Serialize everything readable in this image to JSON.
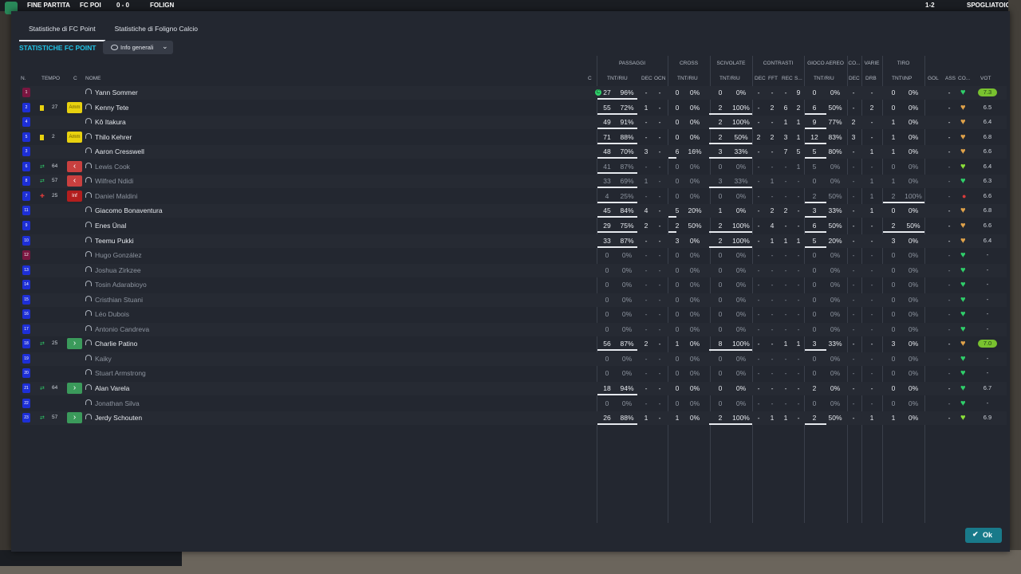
{
  "topbar": {
    "match_label": "FINE PARTITA",
    "home": "FC POI",
    "score": "0 - 0",
    "away": "FOLIGN",
    "page": "1-2",
    "button": "SPOGLIATOIO"
  },
  "tabs": [
    "Statistiche di FC Point",
    "Statistiche di Foligno Calcio"
  ],
  "title": "STATISTICHE FC POINT",
  "dropdown": "Info generali",
  "ok": "Ok",
  "groups": {
    "passaggi": "PASSAGGI",
    "cross": "CROSS",
    "scivolate": "SCIVOLATE",
    "contrasti": "CONTRASTI",
    "gioco_aereo": "GIOCO AEREO",
    "co": "CO...",
    "varie": "VARIE",
    "tiro": "TIRO"
  },
  "headers": {
    "n": "N.",
    "tempo": "TEMPO",
    "c": "C",
    "nome": "NOME",
    "cap": "C",
    "pass_tnt": "TNT/RIU",
    "pass_dec": "DEC",
    "pass_ocn": "OCN",
    "cross_tnt": "TNT/RIU",
    "sciv_tnt": "TNT/RIU",
    "con_dec": "DEC",
    "con_fft": "FFT",
    "con_rec": "REC",
    "con_s": "S...",
    "aer_tnt": "TNT/RIU",
    "co_dec": "DEC",
    "drb": "DRB",
    "tiro": "TNT\\INP",
    "gol": "GOL",
    "ass": "ASS",
    "co2": "CO...",
    "vot": "VOT"
  },
  "players": [
    {
      "n": "1",
      "gk": true,
      "ev": "",
      "min": "",
      "pos": "",
      "name": "Yann Sommer",
      "dim": false,
      "cap": "C",
      "p": [
        "27",
        "96%"
      ],
      "pdec": "-",
      "pocn": "-",
      "cr": [
        "0",
        "0%"
      ],
      "sc": [
        "0",
        "0%"
      ],
      "con": [
        "-",
        "-",
        "-",
        "9"
      ],
      "aer": [
        "0",
        "0%"
      ],
      "codec": "-",
      "drb": "-",
      "tiro": [
        "0",
        "0%"
      ],
      "gol": "",
      "ass": "-",
      "heart": "g",
      "vot": "7.3",
      "hi": true,
      "ulp": true,
      "ulcr": false,
      "ulsc": false,
      "ulaer": false,
      "ultiro": false
    },
    {
      "n": "2",
      "ev": "yc",
      "min": "27",
      "pos": "Amm",
      "name": "Kenny Tete",
      "p": [
        "55",
        "72%"
      ],
      "pdec": "1",
      "pocn": "-",
      "cr": [
        "0",
        "0%"
      ],
      "sc": [
        "2",
        "100%"
      ],
      "con": [
        "-",
        "2",
        "6",
        "2"
      ],
      "aer": [
        "6",
        "50%"
      ],
      "codec": "-",
      "drb": "2",
      "tiro": [
        "0",
        "0%"
      ],
      "ass": "-",
      "heart": "or",
      "vot": "6.5",
      "ulp": true,
      "ulsc": true,
      "ulaer": true
    },
    {
      "n": "4",
      "ev": "",
      "min": "",
      "pos": "",
      "name": "Kô Itakura",
      "p": [
        "49",
        "91%"
      ],
      "pdec": "-",
      "pocn": "-",
      "cr": [
        "0",
        "0%"
      ],
      "sc": [
        "2",
        "100%"
      ],
      "con": [
        "-",
        "-",
        "1",
        "1"
      ],
      "aer": [
        "9",
        "77%"
      ],
      "codec": "2",
      "drb": "-",
      "tiro": [
        "1",
        "0%"
      ],
      "ass": "-",
      "heart": "or",
      "vot": "6.4",
      "ulp": true,
      "ulsc": true,
      "ulaer": true
    },
    {
      "n": "5",
      "ev": "yc",
      "min": "2",
      "pos": "Amm",
      "name": "Thilo Kehrer",
      "p": [
        "71",
        "88%"
      ],
      "pdec": "-",
      "pocn": "-",
      "cr": [
        "0",
        "0%"
      ],
      "sc": [
        "2",
        "50%"
      ],
      "con": [
        "2",
        "2",
        "3",
        "1"
      ],
      "aer": [
        "12",
        "83%"
      ],
      "codec": "3",
      "drb": "-",
      "tiro": [
        "1",
        "0%"
      ],
      "ass": "-",
      "heart": "or",
      "vot": "6.8",
      "ulp": true,
      "ulsc": true,
      "ulaer": true
    },
    {
      "n": "3",
      "ev": "",
      "min": "",
      "pos": "",
      "name": "Aaron Cresswell",
      "p": [
        "48",
        "70%"
      ],
      "pdec": "3",
      "pocn": "-",
      "cr": [
        "6",
        "16%"
      ],
      "sc": [
        "3",
        "33%"
      ],
      "con": [
        "-",
        "-",
        "7",
        "5"
      ],
      "aer": [
        "5",
        "80%"
      ],
      "codec": "-",
      "drb": "1",
      "tiro": [
        "1",
        "0%"
      ],
      "ass": "-",
      "heart": "or",
      "vot": "6.6",
      "ulp": true,
      "ulcr": true,
      "ulsc": true,
      "ulaer": true
    },
    {
      "n": "6",
      "ev": "sub",
      "min": "64",
      "pos": "out",
      "name": "Lewis Cook",
      "dim": true,
      "p": [
        "41",
        "87%"
      ],
      "pdec": "-",
      "pocn": "-",
      "cr": [
        "0",
        "0%"
      ],
      "sc": [
        "0",
        "0%"
      ],
      "con": [
        "-",
        "-",
        "-",
        "1"
      ],
      "aer": [
        "5",
        "0%"
      ],
      "codec": "-",
      "drb": "-",
      "tiro": [
        "0",
        "0%"
      ],
      "ass": "-",
      "heart": "cy",
      "vot": "6.4",
      "ulp": true
    },
    {
      "n": "8",
      "ev": "sub",
      "min": "57",
      "pos": "out",
      "name": "Wilfred Ndidi",
      "dim": true,
      "p": [
        "33",
        "69%"
      ],
      "pdec": "1",
      "pocn": "-",
      "cr": [
        "0",
        "0%"
      ],
      "sc": [
        "3",
        "33%"
      ],
      "con": [
        "-",
        "1",
        "-",
        "-"
      ],
      "aer": [
        "0",
        "0%"
      ],
      "codec": "-",
      "drb": "1",
      "tiro": [
        "1",
        "0%"
      ],
      "ass": "-",
      "heart": "g",
      "vot": "6.3",
      "ulp": true,
      "ulsc": true
    },
    {
      "n": "7",
      "ev": "rc",
      "min": "25",
      "pos": "Inf",
      "name": "Daniel Maldini",
      "dim": true,
      "p": [
        "4",
        "25%"
      ],
      "pdec": "-",
      "pocn": "-",
      "cr": [
        "0",
        "0%"
      ],
      "sc": [
        "0",
        "0%"
      ],
      "con": [
        "-",
        "-",
        "-",
        "-"
      ],
      "aer": [
        "2",
        "50%"
      ],
      "codec": "-",
      "drb": "1",
      "tiro": [
        "2",
        "100%"
      ],
      "ass": "-",
      "heart": "rd",
      "vot": "6.6",
      "ulp": true,
      "ulaer": true,
      "ultiro": true
    },
    {
      "n": "11",
      "ev": "",
      "min": "",
      "pos": "",
      "name": "Giacomo Bonaventura",
      "p": [
        "45",
        "84%"
      ],
      "pdec": "4",
      "pocn": "-",
      "cr": [
        "5",
        "20%"
      ],
      "sc": [
        "1",
        "0%"
      ],
      "con": [
        "-",
        "2",
        "2",
        "-"
      ],
      "aer": [
        "3",
        "33%"
      ],
      "codec": "-",
      "drb": "1",
      "tiro": [
        "0",
        "0%"
      ],
      "ass": "-",
      "heart": "or",
      "vot": "6.8",
      "ulp": true,
      "ulcr": true,
      "ulaer": true
    },
    {
      "n": "9",
      "ev": "",
      "min": "",
      "pos": "",
      "name": "Enes Ünal",
      "p": [
        "29",
        "75%"
      ],
      "pdec": "2",
      "pocn": "-",
      "cr": [
        "2",
        "50%"
      ],
      "sc": [
        "2",
        "100%"
      ],
      "con": [
        "-",
        "4",
        "-",
        "-"
      ],
      "aer": [
        "6",
        "50%"
      ],
      "codec": "-",
      "drb": "-",
      "tiro": [
        "2",
        "50%"
      ],
      "ass": "-",
      "heart": "or",
      "vot": "6.6",
      "ulp": true,
      "ulcr": true,
      "ulsc": true,
      "ulaer": true,
      "ultiro": true
    },
    {
      "n": "10",
      "ev": "",
      "min": "",
      "pos": "",
      "name": "Teemu Pukki",
      "p": [
        "33",
        "87%"
      ],
      "pdec": "-",
      "pocn": "-",
      "cr": [
        "3",
        "0%"
      ],
      "sc": [
        "2",
        "100%"
      ],
      "con": [
        "-",
        "1",
        "1",
        "1"
      ],
      "aer": [
        "5",
        "20%"
      ],
      "codec": "-",
      "drb": "-",
      "tiro": [
        "3",
        "0%"
      ],
      "ass": "-",
      "heart": "or",
      "vot": "6.4",
      "ulp": true,
      "ulsc": true,
      "ulaer": true
    },
    {
      "n": "12",
      "gk": true,
      "ev": "",
      "min": "",
      "pos": "",
      "name": "Hugo González",
      "dim": true,
      "p": [
        "0",
        "0%"
      ],
      "pdec": "-",
      "pocn": "-",
      "cr": [
        "0",
        "0%"
      ],
      "sc": [
        "0",
        "0%"
      ],
      "con": [
        "-",
        "-",
        "-",
        "-"
      ],
      "aer": [
        "0",
        "0%"
      ],
      "codec": "-",
      "drb": "-",
      "tiro": [
        "0",
        "0%"
      ],
      "ass": "-",
      "heart": "g",
      "vot": "-"
    },
    {
      "n": "13",
      "ev": "",
      "min": "",
      "pos": "",
      "name": "Joshua Zirkzee",
      "dim": true,
      "p": [
        "0",
        "0%"
      ],
      "pdec": "-",
      "pocn": "-",
      "cr": [
        "0",
        "0%"
      ],
      "sc": [
        "0",
        "0%"
      ],
      "con": [
        "-",
        "-",
        "-",
        "-"
      ],
      "aer": [
        "0",
        "0%"
      ],
      "codec": "-",
      "drb": "-",
      "tiro": [
        "0",
        "0%"
      ],
      "ass": "-",
      "heart": "g",
      "vot": "-"
    },
    {
      "n": "14",
      "ev": "",
      "min": "",
      "pos": "",
      "name": "Tosin Adarabioyo",
      "dim": true,
      "p": [
        "0",
        "0%"
      ],
      "pdec": "-",
      "pocn": "-",
      "cr": [
        "0",
        "0%"
      ],
      "sc": [
        "0",
        "0%"
      ],
      "con": [
        "-",
        "-",
        "-",
        "-"
      ],
      "aer": [
        "0",
        "0%"
      ],
      "codec": "-",
      "drb": "-",
      "tiro": [
        "0",
        "0%"
      ],
      "ass": "-",
      "heart": "g",
      "vot": "-"
    },
    {
      "n": "15",
      "ev": "",
      "min": "",
      "pos": "",
      "name": "Cristhian Stuani",
      "dim": true,
      "p": [
        "0",
        "0%"
      ],
      "pdec": "-",
      "pocn": "-",
      "cr": [
        "0",
        "0%"
      ],
      "sc": [
        "0",
        "0%"
      ],
      "con": [
        "-",
        "-",
        "-",
        "-"
      ],
      "aer": [
        "0",
        "0%"
      ],
      "codec": "-",
      "drb": "-",
      "tiro": [
        "0",
        "0%"
      ],
      "ass": "-",
      "heart": "g",
      "vot": "-"
    },
    {
      "n": "16",
      "ev": "",
      "min": "",
      "pos": "",
      "name": "Léo Dubois",
      "dim": true,
      "p": [
        "0",
        "0%"
      ],
      "pdec": "-",
      "pocn": "-",
      "cr": [
        "0",
        "0%"
      ],
      "sc": [
        "0",
        "0%"
      ],
      "con": [
        "-",
        "-",
        "-",
        "-"
      ],
      "aer": [
        "0",
        "0%"
      ],
      "codec": "-",
      "drb": "-",
      "tiro": [
        "0",
        "0%"
      ],
      "ass": "-",
      "heart": "g",
      "vot": "-"
    },
    {
      "n": "17",
      "ev": "",
      "min": "",
      "pos": "",
      "name": "Antonio Candreva",
      "dim": true,
      "p": [
        "0",
        "0%"
      ],
      "pdec": "-",
      "pocn": "-",
      "cr": [
        "0",
        "0%"
      ],
      "sc": [
        "0",
        "0%"
      ],
      "con": [
        "-",
        "-",
        "-",
        "-"
      ],
      "aer": [
        "0",
        "0%"
      ],
      "codec": "-",
      "drb": "-",
      "tiro": [
        "0",
        "0%"
      ],
      "ass": "-",
      "heart": "g",
      "vot": "-"
    },
    {
      "n": "18",
      "ev": "sub",
      "min": "25",
      "pos": "in",
      "name": "Charlie Patino",
      "p": [
        "56",
        "87%"
      ],
      "pdec": "2",
      "pocn": "-",
      "cr": [
        "1",
        "0%"
      ],
      "sc": [
        "8",
        "100%"
      ],
      "con": [
        "-",
        "-",
        "1",
        "1"
      ],
      "aer": [
        "3",
        "33%"
      ],
      "codec": "-",
      "drb": "-",
      "tiro": [
        "3",
        "0%"
      ],
      "ass": "-",
      "heart": "or",
      "vot": "7.0",
      "hi": true,
      "ulp": true,
      "ulsc": true,
      "ulaer": true
    },
    {
      "n": "19",
      "ev": "",
      "min": "",
      "pos": "",
      "name": "Kaiky",
      "dim": true,
      "p": [
        "0",
        "0%"
      ],
      "pdec": "-",
      "pocn": "-",
      "cr": [
        "0",
        "0%"
      ],
      "sc": [
        "0",
        "0%"
      ],
      "con": [
        "-",
        "-",
        "-",
        "-"
      ],
      "aer": [
        "0",
        "0%"
      ],
      "codec": "-",
      "drb": "-",
      "tiro": [
        "0",
        "0%"
      ],
      "ass": "-",
      "heart": "g",
      "vot": "-"
    },
    {
      "n": "20",
      "ev": "",
      "min": "",
      "pos": "",
      "name": "Stuart Armstrong",
      "dim": true,
      "p": [
        "0",
        "0%"
      ],
      "pdec": "-",
      "pocn": "-",
      "cr": [
        "0",
        "0%"
      ],
      "sc": [
        "0",
        "0%"
      ],
      "con": [
        "-",
        "-",
        "-",
        "-"
      ],
      "aer": [
        "0",
        "0%"
      ],
      "codec": "-",
      "drb": "-",
      "tiro": [
        "0",
        "0%"
      ],
      "ass": "-",
      "heart": "g",
      "vot": "-"
    },
    {
      "n": "21",
      "ev": "sub",
      "min": "64",
      "pos": "in",
      "name": "Alan Varela",
      "p": [
        "18",
        "94%"
      ],
      "pdec": "-",
      "pocn": "-",
      "cr": [
        "0",
        "0%"
      ],
      "sc": [
        "0",
        "0%"
      ],
      "con": [
        "-",
        "-",
        "-",
        "-"
      ],
      "aer": [
        "2",
        "0%"
      ],
      "codec": "-",
      "drb": "-",
      "tiro": [
        "0",
        "0%"
      ],
      "ass": "-",
      "heart": "g",
      "vot": "6.7",
      "ulp": true
    },
    {
      "n": "22",
      "ev": "",
      "min": "",
      "pos": "",
      "name": "Jonathan Silva",
      "dim": true,
      "p": [
        "0",
        "0%"
      ],
      "pdec": "-",
      "pocn": "-",
      "cr": [
        "0",
        "0%"
      ],
      "sc": [
        "0",
        "0%"
      ],
      "con": [
        "-",
        "-",
        "-",
        "-"
      ],
      "aer": [
        "0",
        "0%"
      ],
      "codec": "-",
      "drb": "-",
      "tiro": [
        "0",
        "0%"
      ],
      "ass": "-",
      "heart": "g",
      "vot": "-"
    },
    {
      "n": "23",
      "ev": "sub",
      "min": "57",
      "pos": "in",
      "name": "Jerdy Schouten",
      "p": [
        "26",
        "88%"
      ],
      "pdec": "1",
      "pocn": "-",
      "cr": [
        "1",
        "0%"
      ],
      "sc": [
        "2",
        "100%"
      ],
      "con": [
        "-",
        "1",
        "1",
        "-"
      ],
      "aer": [
        "2",
        "50%"
      ],
      "codec": "-",
      "drb": "1",
      "tiro": [
        "1",
        "0%"
      ],
      "ass": "-",
      "heart": "cy",
      "vot": "6.9",
      "ulp": true,
      "ulsc": true,
      "ulaer": true
    }
  ]
}
